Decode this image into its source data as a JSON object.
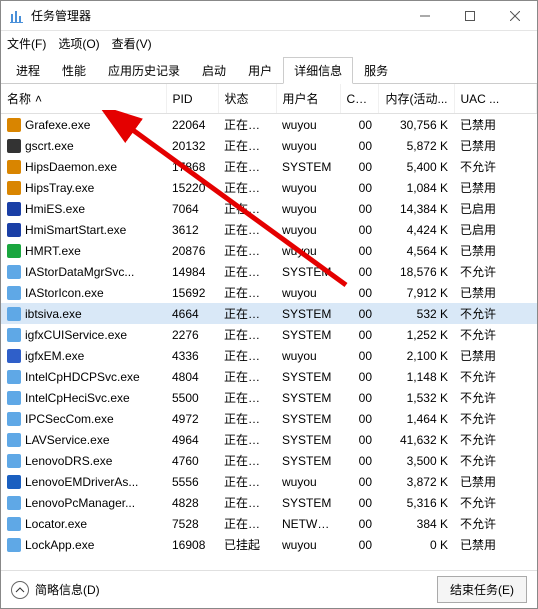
{
  "window": {
    "title": "任务管理器"
  },
  "menu": {
    "file": "文件(F)",
    "options": "选项(O)",
    "view": "查看(V)"
  },
  "tabs": [
    "进程",
    "性能",
    "应用历史记录",
    "启动",
    "用户",
    "详细信息",
    "服务"
  ],
  "activeTab": 5,
  "columns": {
    "name": "名称",
    "pid": "PID",
    "status": "状态",
    "user": "用户名",
    "cpu": "CPU",
    "mem": "内存(活动...",
    "uac": "UAC ..."
  },
  "rows": [
    {
      "name": "Grafexe.exe",
      "pid": "22064",
      "status": "正在运行",
      "user": "wuyou",
      "cpu": "00",
      "mem": "30,756 K",
      "uac": "已禁用",
      "color": "#d98500"
    },
    {
      "name": "gscrt.exe",
      "pid": "20132",
      "status": "正在运行",
      "user": "wuyou",
      "cpu": "00",
      "mem": "5,872 K",
      "uac": "已禁用",
      "color": "#333"
    },
    {
      "name": "HipsDaemon.exe",
      "pid": "17868",
      "status": "正在运行",
      "user": "SYSTEM",
      "cpu": "00",
      "mem": "5,400 K",
      "uac": "不允许",
      "color": "#d98500"
    },
    {
      "name": "HipsTray.exe",
      "pid": "15220",
      "status": "正在运行",
      "user": "wuyou",
      "cpu": "00",
      "mem": "1,084 K",
      "uac": "已禁用",
      "color": "#d98500"
    },
    {
      "name": "HmiES.exe",
      "pid": "7064",
      "status": "正在运行",
      "user": "wuyou",
      "cpu": "00",
      "mem": "14,384 K",
      "uac": "已启用",
      "color": "#1a3fa6"
    },
    {
      "name": "HmiSmartStart.exe",
      "pid": "3612",
      "status": "正在运行",
      "user": "wuyou",
      "cpu": "00",
      "mem": "4,424 K",
      "uac": "已启用",
      "color": "#1a3fa6"
    },
    {
      "name": "HMRT.exe",
      "pid": "20876",
      "status": "正在运行",
      "user": "wuyou",
      "cpu": "00",
      "mem": "4,564 K",
      "uac": "已禁用",
      "color": "#1aa63f"
    },
    {
      "name": "IAStorDataMgrSvc...",
      "pid": "14984",
      "status": "正在运行",
      "user": "SYSTEM",
      "cpu": "00",
      "mem": "18,576 K",
      "uac": "不允许",
      "color": "#5fa8e6"
    },
    {
      "name": "IAStorIcon.exe",
      "pid": "15692",
      "status": "正在运行",
      "user": "wuyou",
      "cpu": "00",
      "mem": "7,912 K",
      "uac": "已禁用",
      "color": "#5fa8e6"
    },
    {
      "name": "ibtsiva.exe",
      "pid": "4664",
      "status": "正在运行",
      "user": "SYSTEM",
      "cpu": "00",
      "mem": "532 K",
      "uac": "不允许",
      "selected": true,
      "color": "#5fa8e6"
    },
    {
      "name": "igfxCUIService.exe",
      "pid": "2276",
      "status": "正在运行",
      "user": "SYSTEM",
      "cpu": "00",
      "mem": "1,252 K",
      "uac": "不允许",
      "color": "#5fa8e6"
    },
    {
      "name": "igfxEM.exe",
      "pid": "4336",
      "status": "正在运行",
      "user": "wuyou",
      "cpu": "00",
      "mem": "2,100 K",
      "uac": "已禁用",
      "color": "#2f5fc9"
    },
    {
      "name": "IntelCpHDCPSvc.exe",
      "pid": "4804",
      "status": "正在运行",
      "user": "SYSTEM",
      "cpu": "00",
      "mem": "1,148 K",
      "uac": "不允许",
      "color": "#5fa8e6"
    },
    {
      "name": "IntelCpHeciSvc.exe",
      "pid": "5500",
      "status": "正在运行",
      "user": "SYSTEM",
      "cpu": "00",
      "mem": "1,532 K",
      "uac": "不允许",
      "color": "#5fa8e6"
    },
    {
      "name": "IPCSecCom.exe",
      "pid": "4972",
      "status": "正在运行",
      "user": "SYSTEM",
      "cpu": "00",
      "mem": "1,464 K",
      "uac": "不允许",
      "color": "#5fa8e6"
    },
    {
      "name": "LAVService.exe",
      "pid": "4964",
      "status": "正在运行",
      "user": "SYSTEM",
      "cpu": "00",
      "mem": "41,632 K",
      "uac": "不允许",
      "color": "#5fa8e6"
    },
    {
      "name": "LenovoDRS.exe",
      "pid": "4760",
      "status": "正在运行",
      "user": "SYSTEM",
      "cpu": "00",
      "mem": "3,500 K",
      "uac": "不允许",
      "color": "#5fa8e6"
    },
    {
      "name": "LenovoEMDriverAs...",
      "pid": "5556",
      "status": "正在运行",
      "user": "wuyou",
      "cpu": "00",
      "mem": "3,872 K",
      "uac": "已禁用",
      "color": "#1a5fc0"
    },
    {
      "name": "LenovoPcManager...",
      "pid": "4828",
      "status": "正在运行",
      "user": "SYSTEM",
      "cpu": "00",
      "mem": "5,316 K",
      "uac": "不允许",
      "color": "#5fa8e6"
    },
    {
      "name": "Locator.exe",
      "pid": "7528",
      "status": "正在运行",
      "user": "NETWOR...",
      "cpu": "00",
      "mem": "384 K",
      "uac": "不允许",
      "color": "#5fa8e6"
    },
    {
      "name": "LockApp.exe",
      "pid": "16908",
      "status": "已挂起",
      "user": "wuyou",
      "cpu": "00",
      "mem": "0 K",
      "uac": "已禁用",
      "color": "#5fa8e6"
    }
  ],
  "footer": {
    "brief": "简略信息(D)",
    "endTask": "结束任务(E)"
  },
  "annotation": {
    "arrowTargetRow": 0
  }
}
